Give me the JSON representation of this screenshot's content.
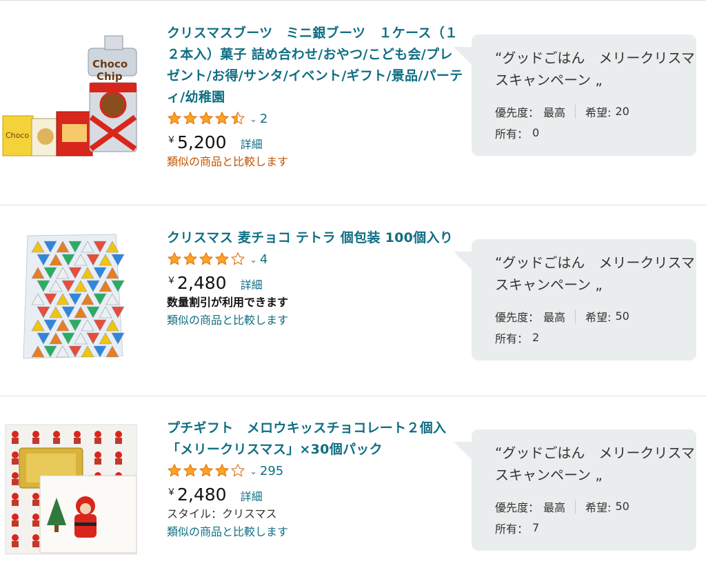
{
  "items": [
    {
      "title": "クリスマスブーツ　ミニ銀ブーツ　１ケース（１２本入）菓子 詰め合わせ/おやつ/こども会/プレゼント/お得/サンタ/イベント/ギフト/景品/パーティ/幼稚園",
      "rating": 4.5,
      "review_count": "2",
      "yen": "￥",
      "price": "5,200",
      "detail_label": "詳細",
      "compare_label": "類似の商品と比較します",
      "list_name": "“グッドごはん　メリークリスマスキャンペーン „",
      "priority_label": "優先度：",
      "priority_value": "最高",
      "desired_label": "希望:",
      "desired_value": "20",
      "owned_label": "所有：",
      "owned_value": "0",
      "image_icon": "christmas-boot-snack-image"
    },
    {
      "title": "クリスマス 麦チョコ テトラ 個包装 100個入り",
      "rating": 4.0,
      "review_count": "4",
      "yen": "￥",
      "price": "2,480",
      "detail_label": "詳細",
      "discount_label": "数量割引が利用できます",
      "compare_label": "類似の商品と比較します",
      "list_name": "“グッドごはん　メリークリスマスキャンペーン „",
      "priority_label": "優先度：",
      "priority_value": "最高",
      "desired_label": "希望:",
      "desired_value": "50",
      "owned_label": "所有：",
      "owned_value": "2",
      "image_icon": "tetra-chocolate-image"
    },
    {
      "title": "プチギフト　メロウキッスチョコレート２個入「メリークリスマス」×30個パック",
      "rating": 4.0,
      "review_count": "295",
      "yen": "￥",
      "price": "2,480",
      "detail_label": "詳細",
      "style_label": "スタイル：クリスマス",
      "compare_label": "類似の商品と比較します",
      "list_name": "“グッドごはん　メリークリスマスキャンペーン „",
      "priority_label": "優先度：",
      "priority_value": "最高",
      "desired_label": "希望:",
      "desired_value": "50",
      "owned_label": "所有：",
      "owned_value": "7",
      "image_icon": "santa-gift-pack-image"
    }
  ],
  "colors": {
    "link": "#0f6e83",
    "star": "#ffa41c",
    "compare_first": "#c45500",
    "bubble_bg": "#eaeded"
  }
}
